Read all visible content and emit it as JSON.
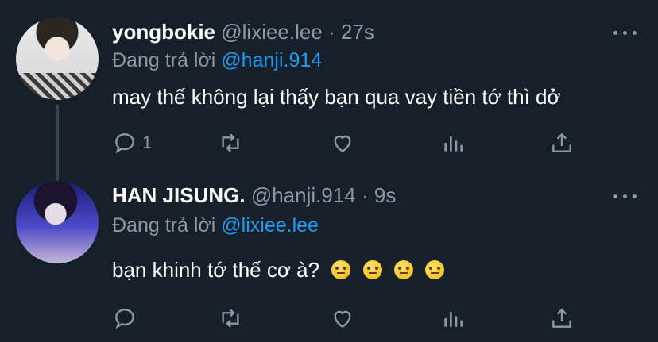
{
  "tweets": [
    {
      "name": "yongbokie",
      "handle": "@lixiee.lee",
      "separator": "·",
      "time": "27s",
      "reply_prefix": "Đang trả lời",
      "reply_to": "@hanji.914",
      "text": "may thế không lại thấy bạn qua vay tiền tớ thì dở",
      "reply_count": "1"
    },
    {
      "name": "HAN JISUNG.",
      "handle": "@hanji.914",
      "separator": "·",
      "time": "9s",
      "reply_prefix": "Đang trả lời",
      "reply_to": "@lixiee.lee",
      "text": "bạn khinh tớ thế cơ à?",
      "emojis": [
        "face-with-raised-eyebrow",
        "face-with-raised-eyebrow",
        "face-with-raised-eyebrow",
        "face-with-raised-eyebrow"
      ],
      "reply_count": ""
    }
  ],
  "icons": [
    "reply-icon",
    "retweet-icon",
    "like-icon",
    "analytics-icon",
    "share-icon",
    "more-icon"
  ]
}
